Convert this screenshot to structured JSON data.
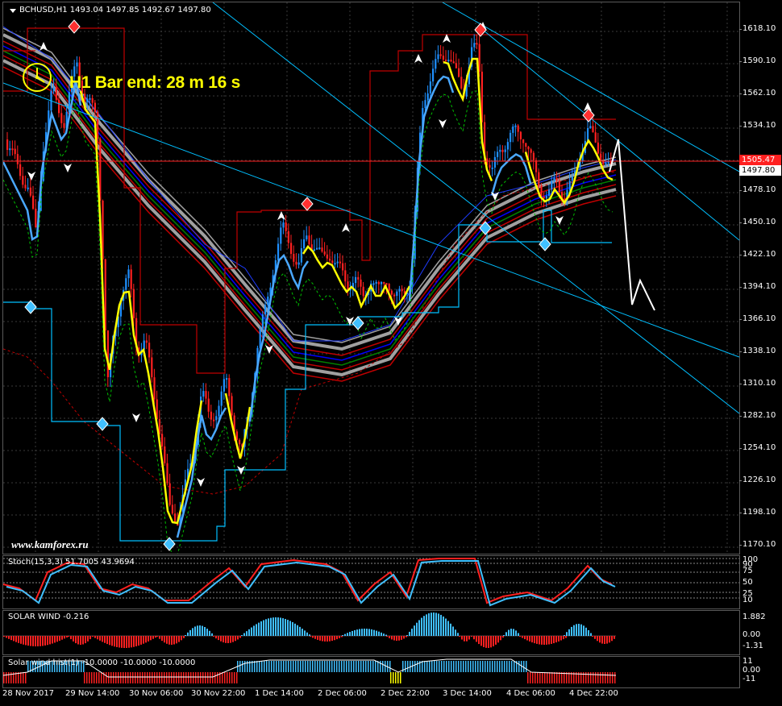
{
  "header": {
    "symbol_title": "BCHUSD,H1  1493.04 1497.85 1492.67 1497.80",
    "timer": "H1 Bar end: 28 m 16 s",
    "watermark": "www.kamforex.ru"
  },
  "price_axis": {
    "labels": [
      "1618.10",
      "1590.10",
      "1562.10",
      "1534.10",
      "1478.10",
      "1450.10",
      "1422.10",
      "1394.10",
      "1366.10",
      "1338.10",
      "1310.10",
      "1282.10",
      "1254.10",
      "1226.10",
      "1198.10",
      "1170.10"
    ],
    "badge_red": "1505.47",
    "badge_white": "1497.80"
  },
  "stoch_pane": {
    "title": "Stoch(15,3,3) 51.7005 43.9694",
    "levels": [
      "100",
      "90",
      "75",
      "50",
      "25",
      "10",
      "0"
    ]
  },
  "solar_pane": {
    "title": "SOLAR WIND -0.216",
    "levels": [
      "1.882",
      "0.00",
      "-1.31"
    ]
  },
  "solar_hist_pane": {
    "title": "Solar wind hist(1) -10.0000 -10.0000 -10.0000",
    "levels": [
      "11",
      "0.00",
      "-11"
    ]
  },
  "time_axis": {
    "labels": [
      "28 Nov 2017",
      "29 Nov 14:00",
      "30 Nov 06:00",
      "30 Nov 22:00",
      "1 Dec 14:00",
      "2 Dec 06:00",
      "2 Dec 22:00",
      "3 Dec 14:00",
      "4 Dec 06:00",
      "4 Dec 22:00"
    ]
  },
  "colors": {
    "background": "#000000",
    "bull": "#1e90ff",
    "bear": "#ff2020",
    "signal": "#ffff00",
    "channel": "#00bfff",
    "envelope": "#c00000",
    "ma_gray": "#a0a0a0"
  }
}
